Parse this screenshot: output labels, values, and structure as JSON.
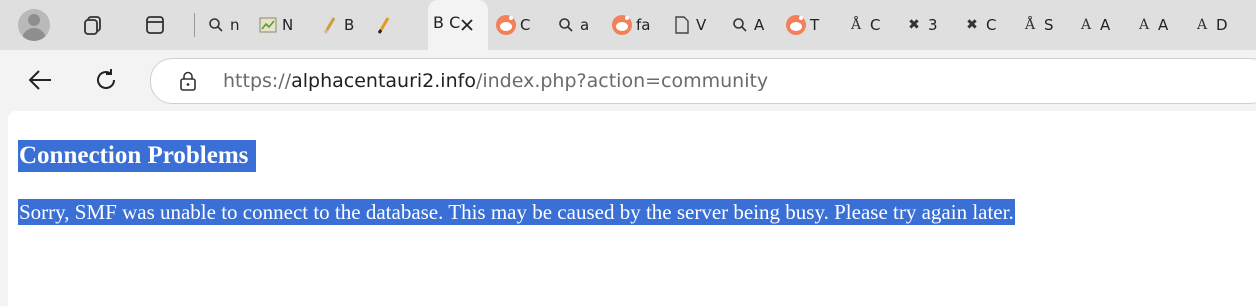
{
  "browser": {
    "active_tab": {
      "label": "B C",
      "close_label": "✕"
    },
    "tabs": [
      {
        "label": "n",
        "icon": "search-icon"
      },
      {
        "label": "N",
        "icon": "image-icon"
      },
      {
        "label": "B",
        "icon": "paintbrush-icon"
      },
      {
        "label": "C",
        "icon": "reddit-icon"
      },
      {
        "label": "a",
        "icon": "search-icon"
      },
      {
        "label": "fa",
        "icon": "reddit-icon"
      },
      {
        "label": "V",
        "icon": "page-icon"
      },
      {
        "label": "A",
        "icon": "search-icon"
      },
      {
        "label": "T",
        "icon": "reddit-icon"
      },
      {
        "label": "C",
        "icon": "triangle-a-icon"
      },
      {
        "label": "3",
        "icon": "x-icon"
      },
      {
        "label": "C",
        "icon": "x-icon"
      },
      {
        "label": "S",
        "icon": "triangle-a-icon"
      },
      {
        "label": "A",
        "icon": "serif-a-icon"
      },
      {
        "label": "A",
        "icon": "serif-a-icon"
      },
      {
        "label": "D",
        "icon": "serif-a-icon"
      }
    ],
    "url": {
      "scheme": "https://",
      "host": "alphacentauri2.info",
      "path": "/index.php?action=community"
    }
  },
  "page": {
    "title": "Connection Problems",
    "message": "Sorry, SMF was unable to connect to the database. This may be caused by the server being busy. Please try again later."
  },
  "colors": {
    "selection": "#3a6fd6",
    "tabstrip": "#dfdfdf",
    "toolbar": "#f3f3f3"
  }
}
